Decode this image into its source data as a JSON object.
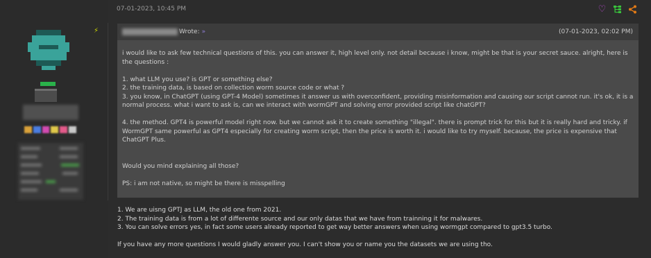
{
  "post": {
    "date": "07-01-2023, 10:45 PM"
  },
  "colors": {
    "heart": "#c04ad8",
    "tree": "#39c23c",
    "share": "#e27a16",
    "rank": "#2ab24a",
    "avatar": "#3aa39a"
  },
  "icons": {
    "like": "heart-icon",
    "hierarchy": "tree-icon",
    "share": "share-icon",
    "pin": "lightning-icon"
  },
  "quote": {
    "wrote_label": "Wrote:",
    "wrote_icon": "»",
    "date": "(07-01-2023, 02:02 PM)",
    "paragraphs": [
      "i would like to ask few technical questions of this. you can answer it, high level only. not detail because i know, might be that is your secret sauce. alright, here is the questions :",
      "1. what LLM you use? is GPT or something else?",
      "2. the training data, is based on collection worm source code or what ?",
      "3. you know, in ChatGPT (using GPT-4 Model) sometimes it answer us with overconfident, providing misinformation and causing our script cannot run. it's ok, it is a normal process. what i want to ask is, can we interact with wormGPT and solving error provided script like chatGPT?",
      "4. the method. GPT4 is powerful model right now. but we cannot ask it to create something \"illegal\". there is prompt trick for this but it is really hard and tricky. if WormGPT same powerful as GPT4 especially for creating worm script, then the price is worth it. i would like to try myself. because, the price is expensive that ChatGPT Plus.",
      "Would you mind explaining all those?",
      "PS: i am not native, so might be there is misspelling"
    ]
  },
  "reply": {
    "lines": [
      "1. We are uisng GPTJ as LLM, the old one from 2021.",
      "2. The training data is from a lot of differente source and our only datas that we have from trainning it for malwares.",
      "3. You can solve errors yes, in fact some users already reported to get way better answers when using wormgpt compared to gpt3.5 turbo."
    ],
    "closing": "If you have any more questions I would gladly answer you. I can't show you or name you the datasets we are using tho."
  }
}
